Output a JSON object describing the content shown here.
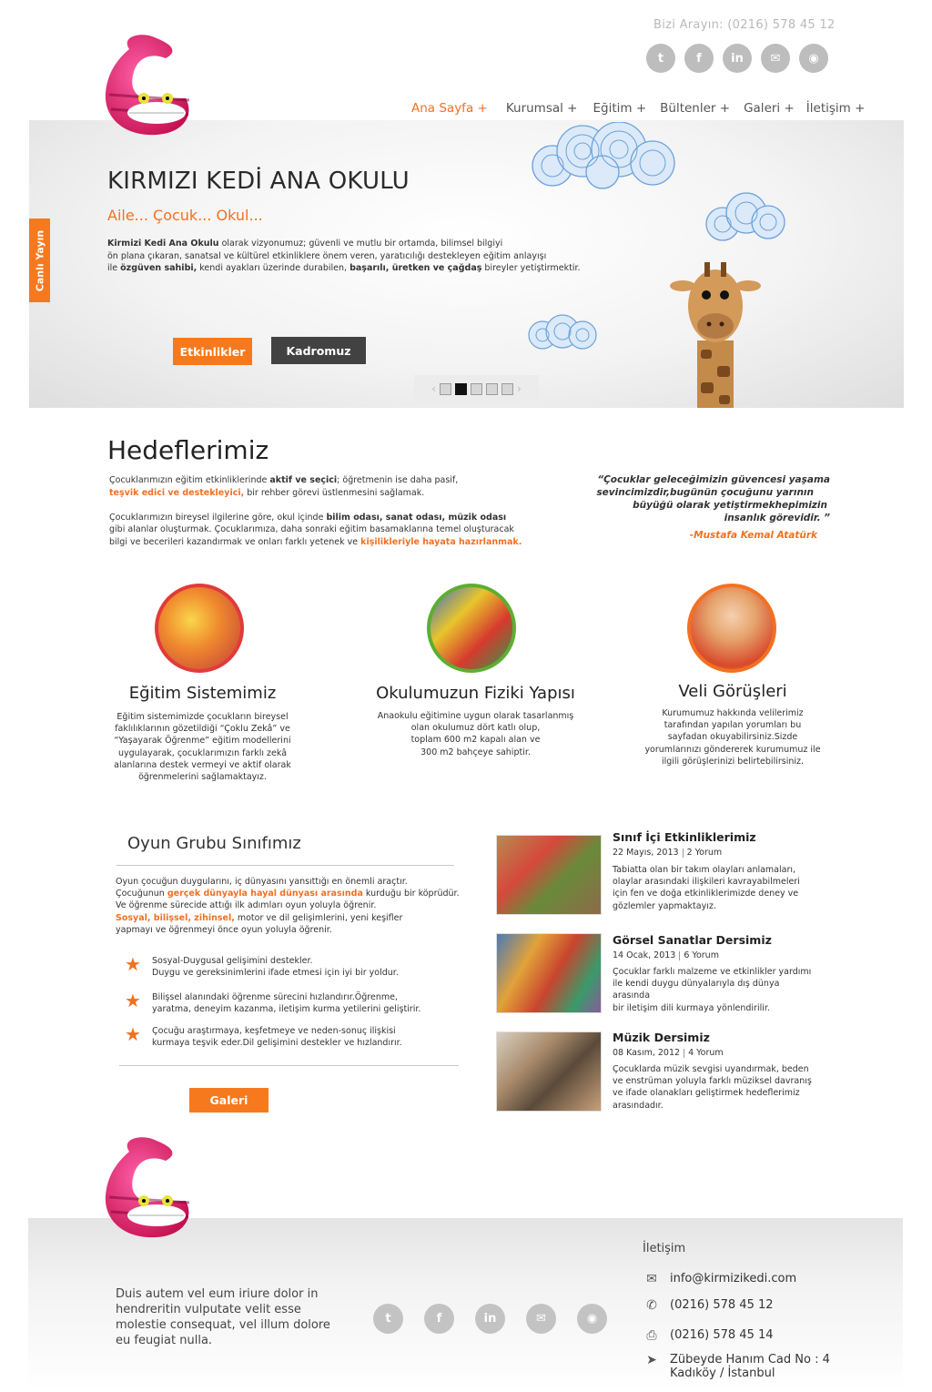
{
  "header": {
    "phone_label": "Bizi Arayın: (0216) 578 45 12",
    "social": [
      "twitter-icon",
      "facebook-icon",
      "linkedin-icon",
      "mail-icon",
      "rss-icon"
    ],
    "nav": [
      "Ana Sayfa +",
      "Kurumsal +",
      "Eğitim +",
      "Bültenler +",
      "Galeri +",
      "İletişim +"
    ]
  },
  "hero": {
    "title": "KIRMIZI KEDİ ANA OKULU",
    "subtitle": "Aile... Çocuk... Okul...",
    "text_brand": "Kirmizi Kedi Ana Okulu",
    "text_1": " olarak vizyonumuz; güvenli ve mutlu bir ortamda, bilimsel bilgiyi",
    "text_2": "ön plana çıkaran, sanatsal ve kültürel etkinliklere önem veren, yaratıcılığı destekleyen eğitim anlayışı",
    "text_3a": "ile ",
    "text_3b": "özgüven sahibi,",
    "text_3c": " kendi ayakları üzerinde durabilen, ",
    "text_3d": "başarılı, üretken ve çağdaş",
    "text_3e": " bireyler yetiştirmektir.",
    "btn_activities": "Etkinlikler",
    "btn_staff": "Kadromuz",
    "live_tab": "Canlı Yayın"
  },
  "goals": {
    "heading": "Hedeflerimiz",
    "p1a": "Çocuklarımızın eğitim etkinliklerinde ",
    "p1b": "aktif ve seçici",
    "p1c": "; öğretmenin ise daha pasif,",
    "p1d": "teşvik edici ve destekleyici,",
    "p1e": " bir rehber görevi üstlenmesini sağlamak.",
    "p2a": "Çocuklarımızın bireysel ilgilerine göre, okul içinde ",
    "p2b": "bilim odası, sanat odası, müzik odası",
    "p2c": "gibi alanlar oluşturmak. Çocuklarımıza, daha sonraki eğitim basamaklarına temel oluşturacak",
    "p2d": "bilgi ve becerileri kazandırmak ve onları farklı yetenek ve ",
    "p2e": "kişilikleriyle hayata hazırlanmak.",
    "quote_1": "“Çocuklar geleceğimizin güvencesi yaşama",
    "quote_2": "sevincimizdir,bugünün çocuğunu yarının",
    "quote_3": "büyüğü olarak yetiştirmekhepimizin",
    "quote_4": "insanlık görevidir. ”",
    "quote_author": "-Mustafa Kemal Atatürk"
  },
  "features": [
    {
      "title": "Eğitim Sistemimiz",
      "lines": [
        "Eğitim sistemimizde çocukların bireysel",
        "faklılıklarının gözetildiği “Çoklu Zekâ” ve",
        "“Yaşayarak Öğrenme” eğitim modellerini",
        "uygulayarak, çocuklarımızın farklı zekâ",
        "alanlarına destek vermeyi ve aktif olarak",
        "öğrenmelerini sağlamaktayız."
      ],
      "border": "#e23a3a"
    },
    {
      "title": "Okulumuzun Fiziki Yapısı",
      "lines": [
        "Anaokulu eğitimine uygun olarak tasarlanmış",
        "olan okulumuz dört katlı olup,",
        "toplam 600 m2 kapalı alan ve",
        "300 m2 bahçeye sahiptir."
      ],
      "border": "#5cae32"
    },
    {
      "title": "Veli Görüşleri",
      "lines": [
        "Kurumumuz hakkında velilerimiz",
        "tarafından yapılan yorumları bu",
        "sayfadan okuyabilirsiniz.Sizde",
        "yorumlarınızı göndererek kurumumuz ile",
        "ilgili görüşlerinizi belirtebilirsiniz."
      ],
      "border": "#f37021"
    }
  ],
  "playgroup": {
    "title": "Oyun Grubu Sınıfımız",
    "l1": "Oyun çocuğun duygularını, iç dünyasını yansıttığı en önemli araçtır.",
    "l2a": "Çocuğunun ",
    "l2b": "gerçek dünyayla hayal dünyası arasında",
    "l2c": " kurduğu bir köprüdür.",
    "l3": "Ve öğrenme sürecide attığı ilk adımları oyun yoluyla öğrenir.",
    "l4a": "Sosyal, bilişsel, zihinsel,",
    "l4b": " motor ve dil gelişimlerini, yeni keşifler",
    "l5": "yapmayı ve öğrenmeyi önce oyun yoluyla öğrenir.",
    "bullets": [
      [
        "Sosyal-Duygusal gelişimini destekler.",
        "Duygu ve gereksinimlerini ifade etmesi için iyi bir yoldur."
      ],
      [
        "Bilişsel alanındaki öğrenme sürecini hızlandırır.Öğrenme,",
        "yaratma, deneyim kazanma, iletişim kurma yetilerini geliştirir."
      ],
      [
        "Çocuğu araştırmaya, keşfetmeye ve neden-sonuç ilişkisi",
        "kurmaya teşvik eder.Dil gelişimini destekler ve hızlandırır."
      ]
    ],
    "btn_gallery": "Galeri"
  },
  "news": [
    {
      "title": "Sınıf İçi Etkinliklerimiz",
      "date": "22 Mayıs, 2013",
      "comments": "2 Yorum",
      "lines": [
        "Tabiatta olan bir takım olayları anlamaları,",
        "olaylar arasındaki ilişkileri kavrayabilmeleri",
        "için fen ve doğa etkinliklerimizde deney ve",
        "gözlemler yapmaktayız."
      ]
    },
    {
      "title": "Görsel Sanatlar Dersimiz",
      "date": "14 Ocak, 2013",
      "comments": "6 Yorum",
      "lines": [
        "Çocuklar farklı malzeme ve etkinlikler yardımı",
        "ile kendi duygu dünyalarıyla dış dünya arasında",
        "bir iletişim dili kurmaya yönlendirilir."
      ]
    },
    {
      "title": "Müzik Dersimiz",
      "date": "08 Kasım, 2012",
      "comments": "4 Yorum",
      "lines": [
        "Çocuklarda müzik sevgisi uyandırmak,  beden",
        "ve enstrüman yoluyla farklı müziksel davranış",
        "ve ifade olanakları geliştirmek hedeflerimiz",
        "arasındadır."
      ]
    }
  ],
  "footer": {
    "text": "Duis autem vel eum iriure dolor in hendreritin vulputate velit esse molestie consequat, vel illum dolore eu feugiat nulla.",
    "contact_heading": "İletişim",
    "email": "info@kirmizikedi.com",
    "phone": "(0216) 578 45 12",
    "fax": "(0216) 578 45 14",
    "address_1": "Zübeyde Hanım Cad No : 4",
    "address_2": "Kadıköy / İstanbul"
  },
  "colors": {
    "accent": "#f37021",
    "dark_button": "#424242"
  }
}
